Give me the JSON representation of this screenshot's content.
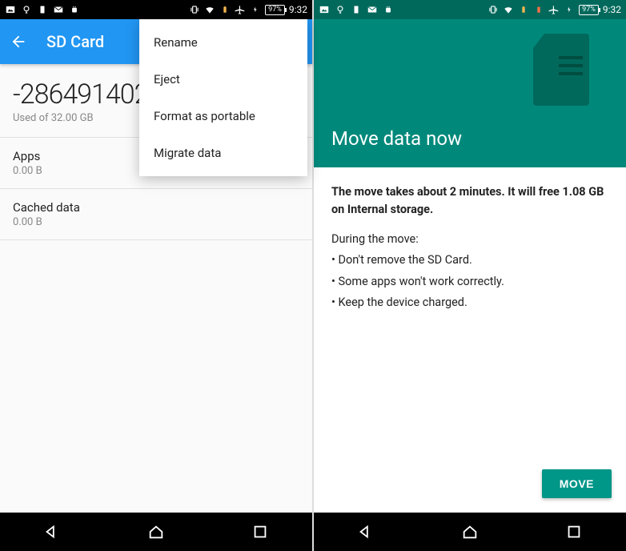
{
  "status": {
    "battery": "97%",
    "time": "9:32"
  },
  "left": {
    "appbar_title": "SD Card",
    "storage_value": "-28649140224.00",
    "storage_value_unit": "B",
    "storage_sub": "Used of 32.00 GB",
    "apps_label": "Apps",
    "apps_value": "0.00 B",
    "cached_label": "Cached data",
    "cached_value": "0.00 B",
    "menu": {
      "rename": "Rename",
      "eject": "Eject",
      "format": "Format as portable",
      "migrate": "Migrate data"
    }
  },
  "right": {
    "hero_title": "Move data now",
    "bold_line": "The move takes about 2 minutes. It will free 1.08 GB on Internal storage.",
    "during_label": "During the move:",
    "bullet1": "• Don't remove the SD Card.",
    "bullet2": "• Some apps won't work correctly.",
    "bullet3": "• Keep the device charged.",
    "move_button": "MOVE"
  }
}
